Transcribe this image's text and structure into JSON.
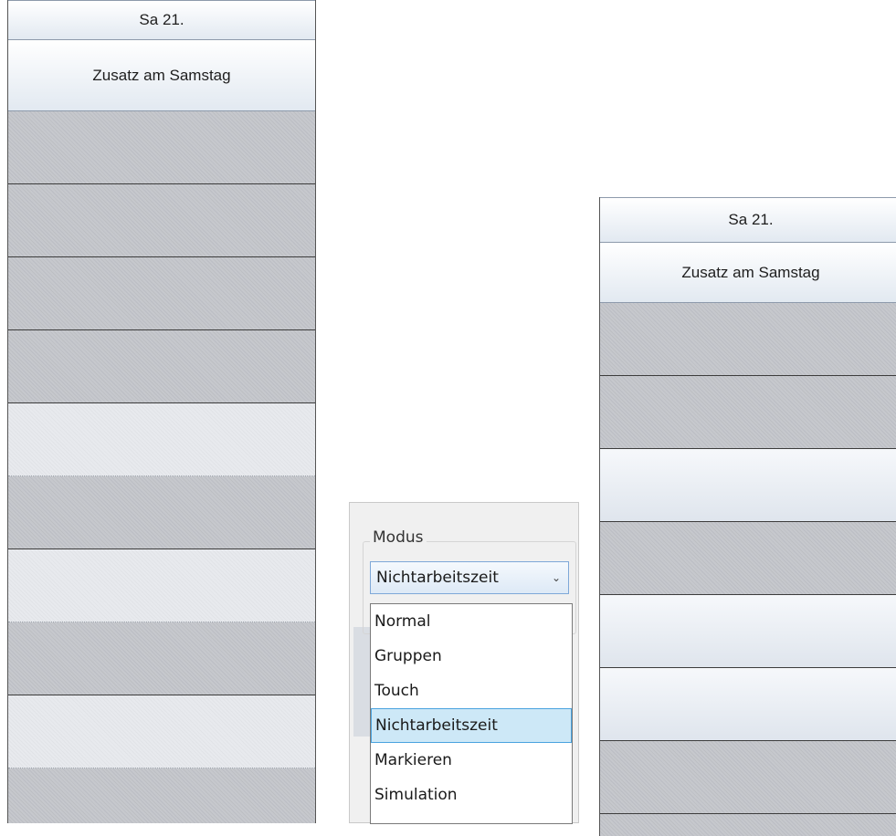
{
  "left_panel": {
    "day_header": "Sa 21.",
    "sub_header": "Zusatz am Samstag"
  },
  "right_panel": {
    "day_header": "Sa 21.",
    "sub_header": "Zusatz am Samstag"
  },
  "modus": {
    "label": "Modus",
    "selected": "Nichtarbeitszeit",
    "options": [
      "Normal",
      "Gruppen",
      "Touch",
      "Nichtarbeitszeit",
      "Markieren",
      "Simulation"
    ]
  },
  "colors": {
    "header_bg": "#e2e9f1",
    "slot_dark": "#c6c8cd",
    "slot_light": "#e8eaee",
    "selection": "#cde8f7"
  }
}
